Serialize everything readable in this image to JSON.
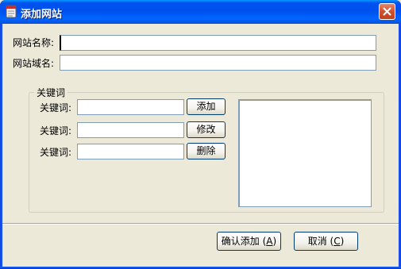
{
  "window": {
    "title": "添加网站",
    "app_icon": "document-app-icon",
    "close_icon": "close-icon"
  },
  "form": {
    "site_name_label": "网站名称:",
    "site_name_value": "",
    "site_domain_label": "网站域名:",
    "site_domain_value": ""
  },
  "keywords": {
    "group_title": "关键词",
    "rows": [
      {
        "label": "关键词:",
        "value": "",
        "button": "添加"
      },
      {
        "label": "关键词:",
        "value": "",
        "button": "修改"
      },
      {
        "label": "关键词:",
        "value": "",
        "button": "删除"
      }
    ],
    "list_items": []
  },
  "footer": {
    "confirm_label": "确认添加",
    "confirm_accel": "A",
    "cancel_label": "取消",
    "cancel_accel": "C"
  },
  "colors": {
    "titlebar": "#0053ee",
    "dialog_bg": "#ece9d8",
    "input_border": "#7f9db9",
    "button_border": "#003c74",
    "close_button": "#d0502d"
  }
}
